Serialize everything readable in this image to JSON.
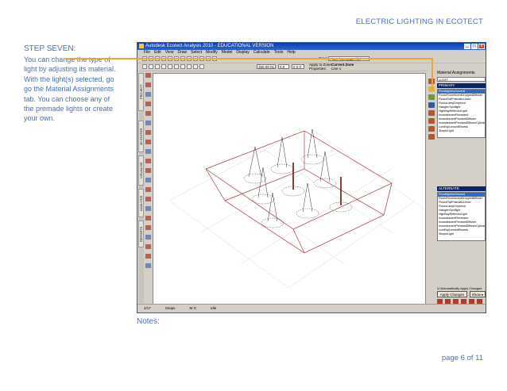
{
  "header": {
    "section_title": "ELECTRIC LIGHTING IN ECOTECT"
  },
  "step": {
    "title": "STEP SEVEN:",
    "lines": [
      "You can change the type of",
      "light by adjusting its material.",
      "With the light(s) selected, go",
      "go the Material Assignments",
      "tab.  You can choose any of",
      "the premade lights or create",
      "your own."
    ]
  },
  "app": {
    "window_title": "Autodesk Ecotect Analysis 2010 - EDUCATIONAL VERSION",
    "menu": [
      "File",
      "Edit",
      "View",
      "Draw",
      "Select",
      "Modify",
      "Model",
      "Display",
      "Calculate",
      "Tools",
      "Help"
    ],
    "toolbar": {
      "zone_label": "Zone:",
      "zone_value": "Floor (No Data File)",
      "fields": [
        "150.00 01.0.0",
        "0.0",
        "0 0 0"
      ],
      "apply_to_zone": "Apply to Zone:",
      "apply_to_zone_value": "Current Zone",
      "properties_label": "Properties:",
      "properties_value": "Line 1"
    },
    "left_tabs": [
      "PROJECT",
      "3D EDITOR",
      "VISUALISE",
      "ANALYSIS",
      "REPORTS"
    ],
    "status": [
      "4/17",
      "Snaps",
      "M G",
      "Idle"
    ],
    "panel": {
      "title": "Material Assignments",
      "dropdown": "LIGHT",
      "primary_label": "PRIMARY",
      "alternate_label": "ALTERNATE",
      "materials": [
        "FloodlightIncGeneral",
        "FluoroFluorescentDroppedDiffuser",
        "FluoroFlatPrismaticLensx",
        "FluoroLampDropIncd",
        "HalogenSpotlight",
        "HighBayReflectorLight",
        "IncandescentRecessed",
        "IncandescentPendantDiffuser",
        "IncandescentPendantDiffuserCylinder",
        "LumEspLensedRecess",
        "SimpleLight"
      ],
      "selected_index": 0,
      "auto_apply": "Automatically Apply Changes",
      "apply_button": "Apply Changes",
      "show_button": "Show ▸"
    }
  },
  "notes_label": "Notes:",
  "page": "page  6 of 11",
  "colors": {
    "accent_text": "#4a6fb5",
    "connector": "#f0a33a",
    "model_lines": "#a04040",
    "selection": "#316ac5"
  }
}
